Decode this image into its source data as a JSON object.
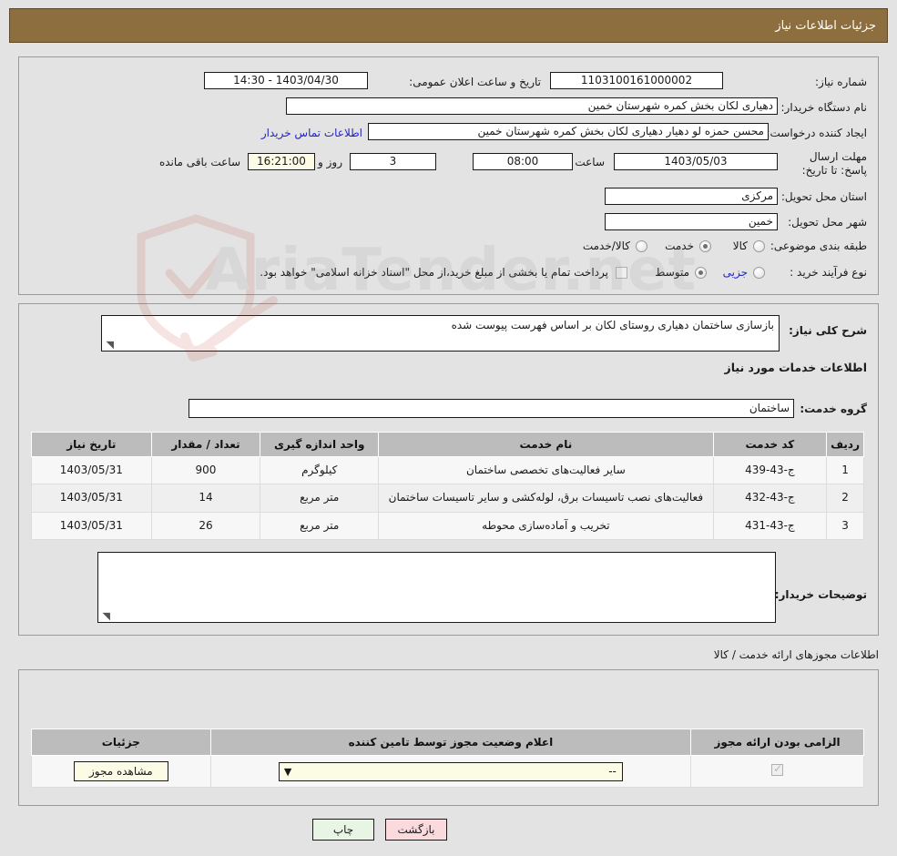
{
  "header": {
    "title": "جزئیات اطلاعات نیاز"
  },
  "main": {
    "need_number_label": "شماره نیاز:",
    "need_number_value": "1103100161000002",
    "public_announce_label": "تاریخ و ساعت اعلان عمومی:",
    "public_announce_value": "1403/04/30 - 14:30",
    "buyer_org_label": "نام دستگاه خریدار:",
    "buyer_org_value": "دهیاری لکان بخش کمره شهرستان خمین",
    "creator_label": "ایجاد کننده درخواست:",
    "creator_value": "محسن حمزه لو دهیار دهیاری لکان بخش کمره شهرستان خمین",
    "contact_link": "اطلاعات تماس خریدار",
    "deadline_label": "مهلت ارسال پاسخ: تا تاریخ:",
    "deadline_date": "1403/05/03",
    "deadline_time_label": "ساعت",
    "deadline_time": "08:00",
    "remaining_days": "3",
    "remaining_days_suffix": "روز و",
    "remaining_clock": "16:21:00",
    "remaining_suffix": "ساعت باقی مانده",
    "province_label": "استان محل تحویل:",
    "province_value": "مرکزی",
    "city_label": "شهر محل تحویل:",
    "city_value": "خمین",
    "category_label": "طبقه بندی موضوعی:",
    "category_options": [
      {
        "label": "کالا",
        "selected": false
      },
      {
        "label": "خدمت",
        "selected": true
      },
      {
        "label": "کالا/خدمت",
        "selected": false
      }
    ],
    "process_label": "نوع فرآیند خرید :",
    "process_options": [
      {
        "label": "جزیی",
        "selected": false
      },
      {
        "label": "متوسط",
        "selected": true
      }
    ],
    "treasury_checked": false,
    "treasury_note": "پرداخت تمام یا بخشی از مبلغ خرید،از محل \"اسناد خزانه اسلامی\" خواهد بود."
  },
  "detail": {
    "general_desc_label": "شرح کلی نیاز:",
    "general_desc_value": "بازسازی ساختمان دهیاری روستای لکان بر اساس فهرست پیوست شده",
    "services_section_title": "اطلاعات خدمات مورد نیاز",
    "service_group_label": "گروه خدمت:",
    "service_group_value": "ساختمان",
    "table_headers": [
      "ردیف",
      "کد خدمت",
      "نام خدمت",
      "واحد اندازه گیری",
      "تعداد / مقدار",
      "تاریخ نیاز"
    ],
    "table_rows": [
      {
        "row": "1",
        "code": "ج-43-439",
        "name": "سایر فعالیت‌های تخصصی ساختمان",
        "unit": "کیلوگرم",
        "qty": "900",
        "date": "1403/05/31"
      },
      {
        "row": "2",
        "code": "ج-43-432",
        "name": "فعالیت‌های نصب تاسیسات برق، لوله‌کشی و سایر تاسیسات ساختمان",
        "unit": "متر مربع",
        "qty": "14",
        "date": "1403/05/31"
      },
      {
        "row": "3",
        "code": "ج-43-431",
        "name": "تخریب و آماده‌سازی محوطه",
        "unit": "متر مربع",
        "qty": "26",
        "date": "1403/05/31"
      }
    ],
    "buyer_notes_label": "توضیحات خریدار:",
    "buyer_notes_value": ""
  },
  "permits": {
    "section_title": "اطلاعات مجوزهای ارائه خدمت / کالا",
    "table_headers": [
      "الزامی بودن ارائه مجوز",
      "اعلام وضعیت مجوز توسط تامین کننده",
      "جزئیات"
    ],
    "rows": [
      {
        "required_checked": true,
        "status_value": "--",
        "details_button": "مشاهده مجوز"
      }
    ]
  },
  "footer": {
    "back_label": "بازگشت",
    "print_label": "چاپ"
  },
  "colors": {
    "title_bar": "#8c6e3f",
    "link": "#2222cc",
    "table_header": "#bcbcbc",
    "cream_field": "#fbfbe6",
    "back_button": "#fadadd",
    "print_button": "#e8f5e4",
    "page_background": "#e3e3e3"
  },
  "watermark": {
    "text": "AriaTender.net"
  }
}
